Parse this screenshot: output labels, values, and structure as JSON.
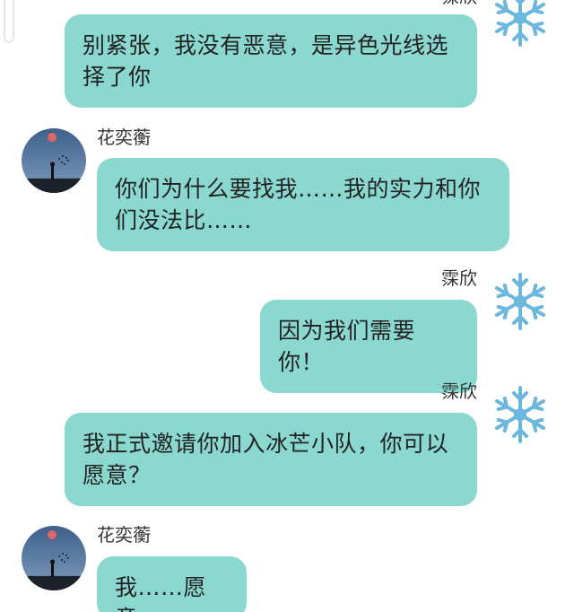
{
  "chat": {
    "top_partial": {
      "sender": "霂欣",
      "text": "别紧张，我没有恶意，是异色光线选择了你"
    },
    "messages": [
      {
        "sender": "花奕蘅",
        "side": "left",
        "text": "你们为什么要找我……我的实力和你们没法比……"
      },
      {
        "sender": "霂欣",
        "side": "right",
        "text": "因为我们需要你！"
      },
      {
        "sender": "霂欣",
        "side": "right",
        "text": "我正式邀请你加入冰芒小队，你可以愿意？"
      },
      {
        "sender": "花奕蘅",
        "side": "left",
        "text": "我……愿意"
      }
    ]
  },
  "avatars": {
    "snowflake": {
      "icon": "snowflake-icon",
      "color": "#6bb7de"
    },
    "night_sky": {
      "icon": "night-sky-moon-avatar",
      "sky": "#4a6e9a",
      "moon": "#e06666"
    }
  },
  "colors": {
    "bubble": "#8ad8cf",
    "background": "#ffffff",
    "name_text": "#333333",
    "message_text": "#222222"
  }
}
